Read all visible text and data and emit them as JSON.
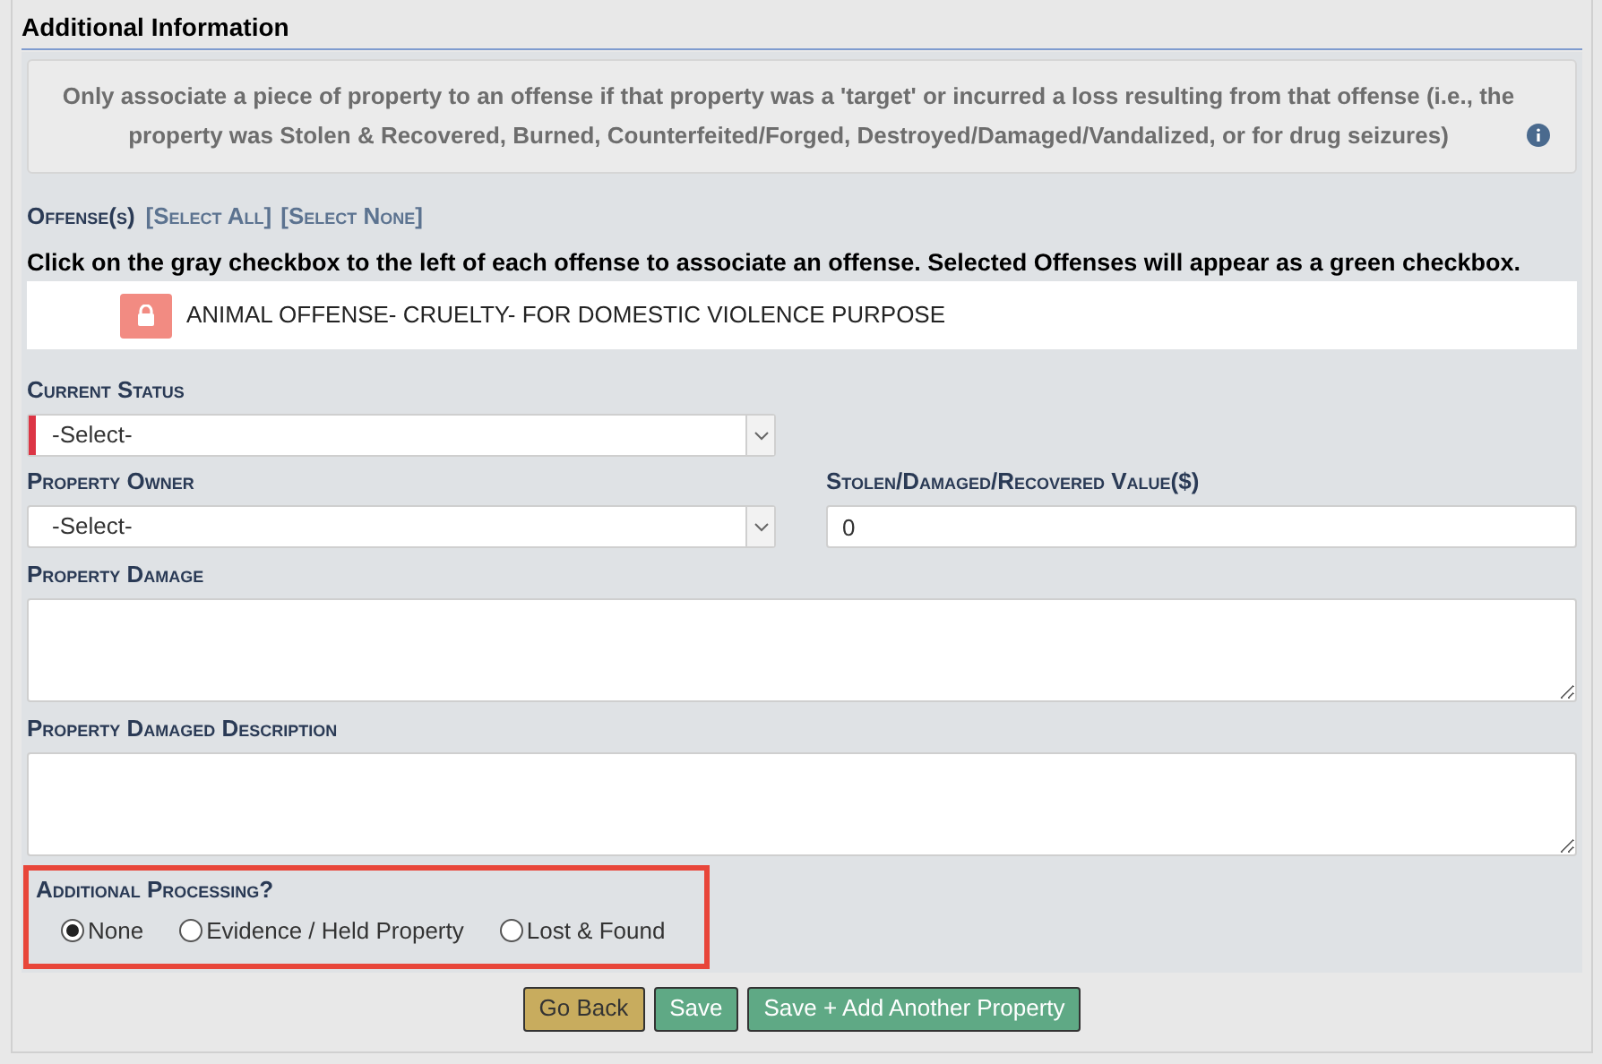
{
  "section_title": "Additional Information",
  "notice": {
    "text": "Only associate a piece of property to an offense if that property was a 'target' or incurred a loss resulting from that offense (i.e., the property was Stolen & Recovered, Burned, Counterfeited/Forged, Destroyed/Damaged/Vandalized, or for drug seizures)"
  },
  "offenses": {
    "label": "Offense(s)",
    "links": [
      "[Select All]",
      "[Select None]"
    ],
    "instruction": "Click on the gray checkbox to the left of each offense to associate an offense. Selected Offenses will appear as a green checkbox.",
    "items": [
      {
        "name": "ANIMAL OFFENSE- CRUELTY- FOR DOMESTIC VIOLENCE PURPOSE",
        "locked": true
      }
    ]
  },
  "current_status": {
    "label": "Current Status",
    "value": "-Select-",
    "required": true
  },
  "property_owner": {
    "label": "Property Owner",
    "value": "-Select-",
    "required": false
  },
  "value_field": {
    "label": "Stolen/Damaged/Recovered Value($)",
    "value": "0"
  },
  "property_damage": {
    "label": "Property Damage"
  },
  "damage_description": {
    "label": "Property Damaged Description"
  },
  "additional_processing": {
    "label": "Additional Processing?",
    "highlighted": true,
    "options": [
      {
        "label": "None",
        "selected": true
      },
      {
        "label": "Evidence / Held Property",
        "selected": false
      },
      {
        "label": "Lost & Found",
        "selected": false
      }
    ]
  },
  "buttons": [
    {
      "label": "Go Back",
      "kind": "back"
    },
    {
      "label": "Save",
      "kind": "save"
    },
    {
      "label": "Save + Add Another Property",
      "kind": "save"
    }
  ]
}
